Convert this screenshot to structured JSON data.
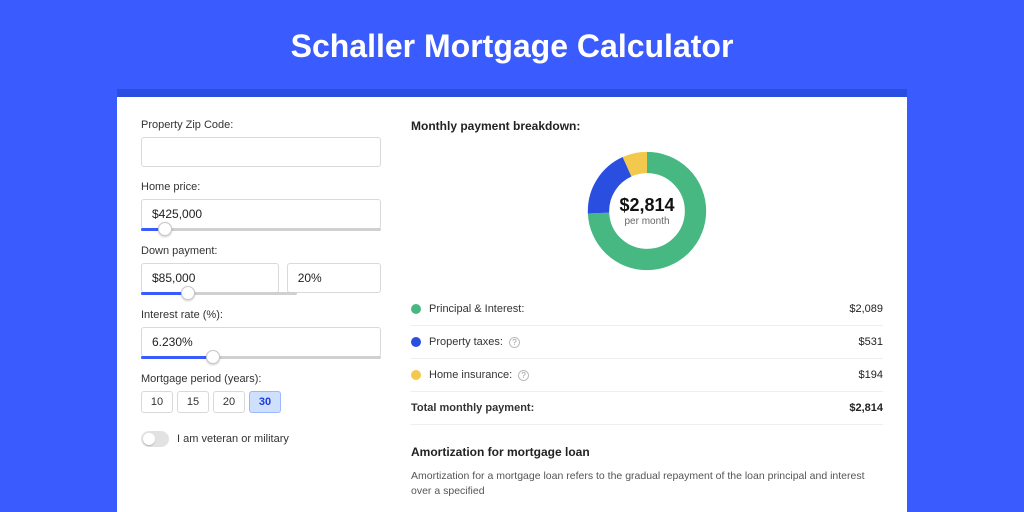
{
  "title": "Schaller Mortgage Calculator",
  "form": {
    "zip": {
      "label": "Property Zip Code:",
      "value": ""
    },
    "home_price": {
      "label": "Home price:",
      "value": "$425,000",
      "slider_pct": 10
    },
    "down_payment": {
      "label": "Down payment:",
      "amount": "$85,000",
      "percent": "20%",
      "slider_pct": 20
    },
    "interest_rate": {
      "label": "Interest rate (%):",
      "value": "6.230%",
      "slider_pct": 30
    },
    "period": {
      "label": "Mortgage period (years):",
      "options": [
        "10",
        "15",
        "20",
        "30"
      ],
      "selected": "30"
    },
    "veteran": {
      "label": "I am veteran or military",
      "on": false
    }
  },
  "breakdown": {
    "heading": "Monthly payment breakdown:",
    "center_amount": "$2,814",
    "center_sub": "per month",
    "items": [
      {
        "label": "Principal & Interest:",
        "value": "$2,089",
        "color": "#47b881",
        "has_info": false
      },
      {
        "label": "Property taxes:",
        "value": "$531",
        "color": "#2a4ee0",
        "has_info": true
      },
      {
        "label": "Home insurance:",
        "value": "$194",
        "color": "#f2c94c",
        "has_info": true
      }
    ],
    "total": {
      "label": "Total monthly payment:",
      "value": "$2,814"
    }
  },
  "amortization": {
    "heading": "Amortization for mortgage loan",
    "body": "Amortization for a mortgage loan refers to the gradual repayment of the loan principal and interest over a specified"
  },
  "chart_data": {
    "type": "pie",
    "title": "Monthly payment breakdown",
    "series": [
      {
        "name": "Principal & Interest",
        "value": 2089,
        "color": "#47b881"
      },
      {
        "name": "Property taxes",
        "value": 531,
        "color": "#2a4ee0"
      },
      {
        "name": "Home insurance",
        "value": 194,
        "color": "#f2c94c"
      }
    ],
    "total": 2814,
    "center_label": "$2,814 per month"
  }
}
